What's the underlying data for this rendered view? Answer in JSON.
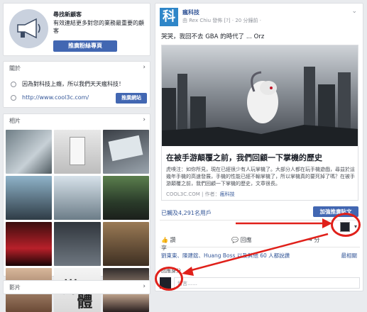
{
  "promo": {
    "title": "尋找新顧客",
    "desc": "有效連結更多對您的業務最重要的顧客",
    "button": "推廣粉絲專頁"
  },
  "about": {
    "heading": "關於",
    "line1": "因為對科技上癮，所以我們天天瘋科技！",
    "url": "http://www.cool3c.com/",
    "button": "推廣網站"
  },
  "photos": {
    "heading": "相片"
  },
  "videos": {
    "heading": "影片"
  },
  "post": {
    "avatar_text": "科",
    "page_name": "瘋科技",
    "meta": "由 Rex Chiu 發佈 [?] · 20 分鐘前 · ",
    "text": "哭哭，我回不去 GBA 的時代了 ... Orz",
    "link_title": "在被手游顛覆之前，我們回顧一下掌機的歷史",
    "link_desc": "虎嗅注：如你所見，現在已經很少有人玩掌機了。大部分人都在玩手機遊戲，尋益於這幾年手機的高速發展，手機的性能已經不輸掌機了，所以掌機真的要死掉了嗎？在被手游顛覆之前，我們回顧一下掌機的歷史，文章很長。",
    "link_src": "COOL3C.COM | 作者：",
    "link_author": "瘋科技",
    "reach": "已觸及4,291名用戶",
    "boost": "加強推廣貼文",
    "like": "讚",
    "comment": "回應",
    "share": "分享",
    "likes_line": "劉東東、陳建鋐、Huang Boss 以及其他 60 人都說讚",
    "sort": "最相關",
    "comment_as": "回應身分",
    "comment_placeholder": "留言……"
  }
}
